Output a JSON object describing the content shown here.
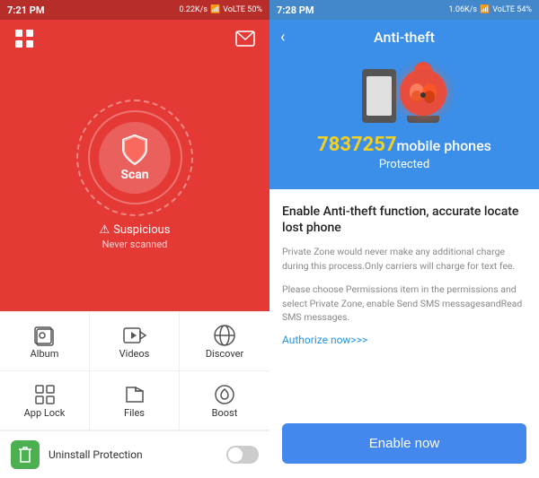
{
  "left": {
    "status_bar": {
      "time": "7:21 PM",
      "signal": "0.22K/s",
      "indicators": "VoLTE 50%"
    },
    "scan_button": "Scan",
    "suspicious_label": "Suspicious",
    "never_scanned": "Never scanned",
    "grid_items": [
      {
        "id": "album",
        "label": "Album",
        "icon": "album-icon"
      },
      {
        "id": "videos",
        "label": "Videos",
        "icon": "video-icon"
      },
      {
        "id": "discover",
        "label": "Discover",
        "icon": "discover-icon"
      },
      {
        "id": "applock",
        "label": "App Lock",
        "icon": "applock-icon"
      },
      {
        "id": "files",
        "label": "Files",
        "icon": "files-icon"
      },
      {
        "id": "boost",
        "label": "Boost",
        "icon": "boost-icon"
      }
    ],
    "bottom_item": "Uninstall Protection"
  },
  "right": {
    "status_bar": {
      "time": "7:28 PM",
      "signal": "1.06K/s",
      "indicators": "VoLTE 54%"
    },
    "title": "Anti-theft",
    "count": "7837257",
    "count_suffix": "mobile phones",
    "protected_label": "Protected",
    "content_title": "Enable Anti-theft function, accurate locate lost phone",
    "desc1": "Private Zone would never make any additional charge during this process.Only carriers will charge for text fee.",
    "desc2": "Please choose Permissions item in the permissions and select Private Zone, enable Send SMS messagesandRead SMS messages.",
    "authorize_link": "Authorize now>>>",
    "enable_button": "Enable now"
  }
}
